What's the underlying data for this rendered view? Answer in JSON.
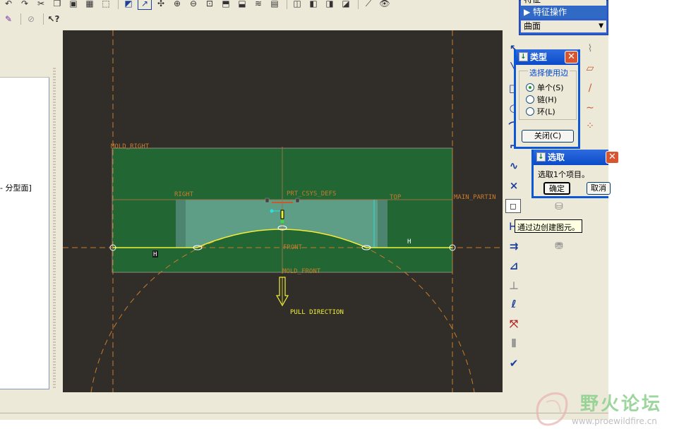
{
  "window": {
    "title": ""
  },
  "toolbar": {
    "row1_icons": [
      "undo-icon",
      "redo-icon",
      "cut-icon",
      "copy-icon",
      "paste-icon",
      "regenerate-icon",
      "select-box-icon",
      "sketch-icon",
      "curve-icon",
      "orient-icon",
      "zoom-in-icon",
      "zoom-out-icon",
      "refit-icon",
      "view-icon",
      "datum-display-icon",
      "layers-icon",
      "saved-views-icon",
      "wireframe-icon",
      "hidden-line-icon",
      "no-hidden-icon",
      "shading-icon",
      "datum-planes-icon",
      "visibility-icon"
    ],
    "row2_icons": [
      "sketch-tool-icon",
      "hide-icon",
      "whats-this-icon"
    ]
  },
  "menu": {
    "top_item": "特征",
    "selected_item": "特征操作",
    "dropdown_value": "曲面"
  },
  "tree": {
    "item_label": "- 分型面]"
  },
  "viewport": {
    "labels": {
      "mold_right": "MOLD_RIGHT",
      "right": "RIGHT",
      "prt_csys_defs": "PRT_CSYS_DEFS",
      "top": "TOP",
      "main_parting": "MAIN_PARTIN",
      "front": "FRONT",
      "mold_front": "MOLD_FRONT",
      "pull_direction": "PULL DIRECTION",
      "h_marker": "H"
    },
    "colors": {
      "background": "#312e29",
      "mold_green": "#216633",
      "part_teal": "#5e9e86",
      "datum_orange": "#c87c2e",
      "edge_yellow": "#f0f038",
      "cyan": "#29e0e0"
    }
  },
  "type_dialog": {
    "title": "类型",
    "group_label": "选择使用边",
    "options": [
      {
        "label": "单个(S)",
        "selected": true
      },
      {
        "label": "链(H)",
        "selected": false
      },
      {
        "label": "环(L)",
        "selected": false
      }
    ],
    "close_button": "关闭(C)"
  },
  "select_dialog": {
    "title": "选取",
    "message": "选取1个项目。",
    "ok_button": "确定",
    "cancel_button": "取消"
  },
  "tooltip": {
    "text": "通过边创建图元。"
  },
  "right_toolbar": {
    "icons": [
      "select-arrow-icon",
      "line-icon",
      "rectangle-icon",
      "circle-icon",
      "arc-icon",
      "fillet-icon",
      "spline-icon",
      "point-icon",
      "use-edge-icon",
      "offset-edge-icon",
      "dimension-icon",
      "modify-icon",
      "constraint-icon",
      "text-icon",
      "palette-icon",
      "trim-icon",
      "mirror-icon",
      "done-check-icon"
    ]
  },
  "watermark": {
    "text": "野火论坛",
    "url": "www.proewildfire.cn"
  }
}
